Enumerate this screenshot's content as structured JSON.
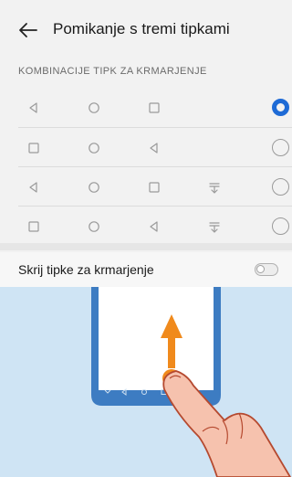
{
  "header": {
    "title": "Pomikanje s tremi tipkami",
    "back_icon": "back-arrow-icon"
  },
  "section": {
    "title": "KOMBINACIJE TIPK ZA KRMARJENJE"
  },
  "combinations": [
    {
      "keys": [
        "back",
        "home",
        "recent"
      ],
      "selected": true
    },
    {
      "keys": [
        "recent",
        "home",
        "back"
      ],
      "selected": false
    },
    {
      "keys": [
        "back",
        "home",
        "recent",
        "notification"
      ],
      "selected": false
    },
    {
      "keys": [
        "recent",
        "home",
        "back",
        "notification"
      ],
      "selected": false
    }
  ],
  "hide_keys": {
    "label": "Skrij tipke za krmarjenje",
    "enabled": false
  },
  "colors": {
    "accent": "#1e6bd6",
    "arrow": "#f08a1c",
    "phone": "#3d7cc2",
    "illustration_bg": "#cfe4f4"
  }
}
